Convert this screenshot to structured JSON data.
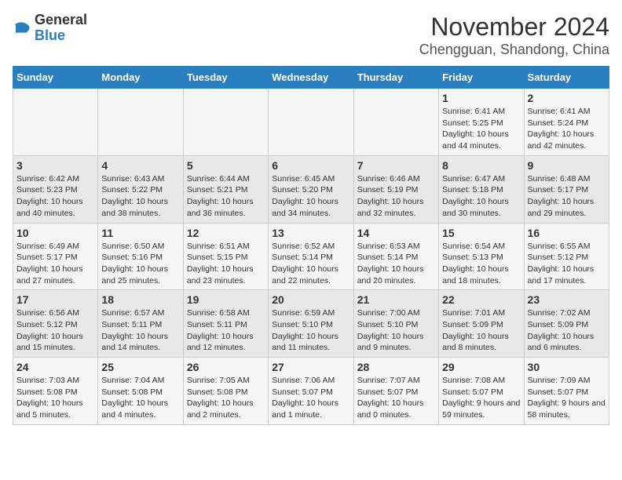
{
  "logo": {
    "text_general": "General",
    "text_blue": "Blue"
  },
  "header": {
    "month": "November 2024",
    "location": "Chengguan, Shandong, China"
  },
  "weekdays": [
    "Sunday",
    "Monday",
    "Tuesday",
    "Wednesday",
    "Thursday",
    "Friday",
    "Saturday"
  ],
  "weeks": [
    [
      {
        "day": "",
        "info": ""
      },
      {
        "day": "",
        "info": ""
      },
      {
        "day": "",
        "info": ""
      },
      {
        "day": "",
        "info": ""
      },
      {
        "day": "",
        "info": ""
      },
      {
        "day": "1",
        "info": "Sunrise: 6:41 AM\nSunset: 5:25 PM\nDaylight: 10 hours\nand 44 minutes."
      },
      {
        "day": "2",
        "info": "Sunrise: 6:41 AM\nSunset: 5:24 PM\nDaylight: 10 hours\nand 42 minutes."
      }
    ],
    [
      {
        "day": "3",
        "info": "Sunrise: 6:42 AM\nSunset: 5:23 PM\nDaylight: 10 hours\nand 40 minutes."
      },
      {
        "day": "4",
        "info": "Sunrise: 6:43 AM\nSunset: 5:22 PM\nDaylight: 10 hours\nand 38 minutes."
      },
      {
        "day": "5",
        "info": "Sunrise: 6:44 AM\nSunset: 5:21 PM\nDaylight: 10 hours\nand 36 minutes."
      },
      {
        "day": "6",
        "info": "Sunrise: 6:45 AM\nSunset: 5:20 PM\nDaylight: 10 hours\nand 34 minutes."
      },
      {
        "day": "7",
        "info": "Sunrise: 6:46 AM\nSunset: 5:19 PM\nDaylight: 10 hours\nand 32 minutes."
      },
      {
        "day": "8",
        "info": "Sunrise: 6:47 AM\nSunset: 5:18 PM\nDaylight: 10 hours\nand 30 minutes."
      },
      {
        "day": "9",
        "info": "Sunrise: 6:48 AM\nSunset: 5:17 PM\nDaylight: 10 hours\nand 29 minutes."
      }
    ],
    [
      {
        "day": "10",
        "info": "Sunrise: 6:49 AM\nSunset: 5:17 PM\nDaylight: 10 hours\nand 27 minutes."
      },
      {
        "day": "11",
        "info": "Sunrise: 6:50 AM\nSunset: 5:16 PM\nDaylight: 10 hours\nand 25 minutes."
      },
      {
        "day": "12",
        "info": "Sunrise: 6:51 AM\nSunset: 5:15 PM\nDaylight: 10 hours\nand 23 minutes."
      },
      {
        "day": "13",
        "info": "Sunrise: 6:52 AM\nSunset: 5:14 PM\nDaylight: 10 hours\nand 22 minutes."
      },
      {
        "day": "14",
        "info": "Sunrise: 6:53 AM\nSunset: 5:14 PM\nDaylight: 10 hours\nand 20 minutes."
      },
      {
        "day": "15",
        "info": "Sunrise: 6:54 AM\nSunset: 5:13 PM\nDaylight: 10 hours\nand 18 minutes."
      },
      {
        "day": "16",
        "info": "Sunrise: 6:55 AM\nSunset: 5:12 PM\nDaylight: 10 hours\nand 17 minutes."
      }
    ],
    [
      {
        "day": "17",
        "info": "Sunrise: 6:56 AM\nSunset: 5:12 PM\nDaylight: 10 hours\nand 15 minutes."
      },
      {
        "day": "18",
        "info": "Sunrise: 6:57 AM\nSunset: 5:11 PM\nDaylight: 10 hours\nand 14 minutes."
      },
      {
        "day": "19",
        "info": "Sunrise: 6:58 AM\nSunset: 5:11 PM\nDaylight: 10 hours\nand 12 minutes."
      },
      {
        "day": "20",
        "info": "Sunrise: 6:59 AM\nSunset: 5:10 PM\nDaylight: 10 hours\nand 11 minutes."
      },
      {
        "day": "21",
        "info": "Sunrise: 7:00 AM\nSunset: 5:10 PM\nDaylight: 10 hours\nand 9 minutes."
      },
      {
        "day": "22",
        "info": "Sunrise: 7:01 AM\nSunset: 5:09 PM\nDaylight: 10 hours\nand 8 minutes."
      },
      {
        "day": "23",
        "info": "Sunrise: 7:02 AM\nSunset: 5:09 PM\nDaylight: 10 hours\nand 6 minutes."
      }
    ],
    [
      {
        "day": "24",
        "info": "Sunrise: 7:03 AM\nSunset: 5:08 PM\nDaylight: 10 hours\nand 5 minutes."
      },
      {
        "day": "25",
        "info": "Sunrise: 7:04 AM\nSunset: 5:08 PM\nDaylight: 10 hours\nand 4 minutes."
      },
      {
        "day": "26",
        "info": "Sunrise: 7:05 AM\nSunset: 5:08 PM\nDaylight: 10 hours\nand 2 minutes."
      },
      {
        "day": "27",
        "info": "Sunrise: 7:06 AM\nSunset: 5:07 PM\nDaylight: 10 hours\nand 1 minute."
      },
      {
        "day": "28",
        "info": "Sunrise: 7:07 AM\nSunset: 5:07 PM\nDaylight: 10 hours\nand 0 minutes."
      },
      {
        "day": "29",
        "info": "Sunrise: 7:08 AM\nSunset: 5:07 PM\nDaylight: 9 hours\nand 59 minutes."
      },
      {
        "day": "30",
        "info": "Sunrise: 7:09 AM\nSunset: 5:07 PM\nDaylight: 9 hours\nand 58 minutes."
      }
    ]
  ]
}
